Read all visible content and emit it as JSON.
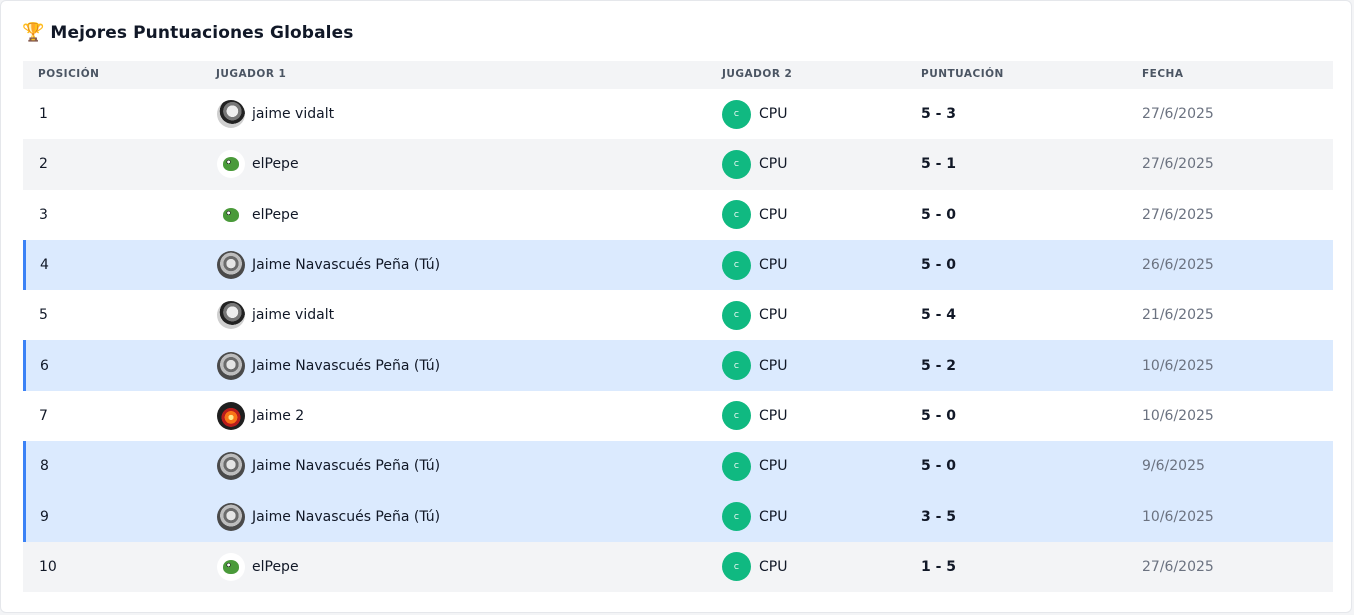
{
  "header": {
    "icon": "trophy-icon",
    "title": "Mejores Puntuaciones Globales"
  },
  "columns": {
    "position": "POSICIÓN",
    "player1": "JUGADOR 1",
    "player2": "JUGADOR 2",
    "score": "PUNTUACIÓN",
    "date": "FECHA"
  },
  "cpu_badge": "C",
  "rows": [
    {
      "position": "1",
      "player1": "jaime vidalt",
      "avatar": "bw-photo",
      "player2": "CPU",
      "score": "5 - 3",
      "date": "27/6/2025",
      "highlight": false
    },
    {
      "position": "2",
      "player1": "elPepe",
      "avatar": "pepe-frog",
      "player2": "CPU",
      "score": "5 - 1",
      "date": "27/6/2025",
      "highlight": false
    },
    {
      "position": "3",
      "player1": "elPepe",
      "avatar": "pepe-frog",
      "player2": "CPU",
      "score": "5 - 0",
      "date": "27/6/2025",
      "highlight": false
    },
    {
      "position": "4",
      "player1": "Jaime Navascués Peña (Tú)",
      "avatar": "car-photo",
      "player2": "CPU",
      "score": "5 - 0",
      "date": "26/6/2025",
      "highlight": true
    },
    {
      "position": "5",
      "player1": "jaime vidalt",
      "avatar": "bw-photo",
      "player2": "CPU",
      "score": "5 - 4",
      "date": "21/6/2025",
      "highlight": false
    },
    {
      "position": "6",
      "player1": "Jaime Navascués Peña (Tú)",
      "avatar": "car-photo",
      "player2": "CPU",
      "score": "5 - 2",
      "date": "10/6/2025",
      "highlight": true
    },
    {
      "position": "7",
      "player1": "Jaime 2",
      "avatar": "fire-icon",
      "player2": "CPU",
      "score": "5 - 0",
      "date": "10/6/2025",
      "highlight": false
    },
    {
      "position": "8",
      "player1": "Jaime Navascués Peña (Tú)",
      "avatar": "car-photo",
      "player2": "CPU",
      "score": "5 - 0",
      "date": "9/6/2025",
      "highlight": true
    },
    {
      "position": "9",
      "player1": "Jaime Navascués Peña (Tú)",
      "avatar": "car-photo",
      "player2": "CPU",
      "score": "3 - 5",
      "date": "10/6/2025",
      "highlight": true
    },
    {
      "position": "10",
      "player1": "elPepe",
      "avatar": "pepe-frog",
      "player2": "CPU",
      "score": "1 - 5",
      "date": "27/6/2025",
      "highlight": false
    }
  ],
  "colors": {
    "highlight_bg": "#dbeafe",
    "highlight_bar": "#3b82f6",
    "cpu_badge": "#10b981",
    "stripe": "#f3f4f6"
  }
}
